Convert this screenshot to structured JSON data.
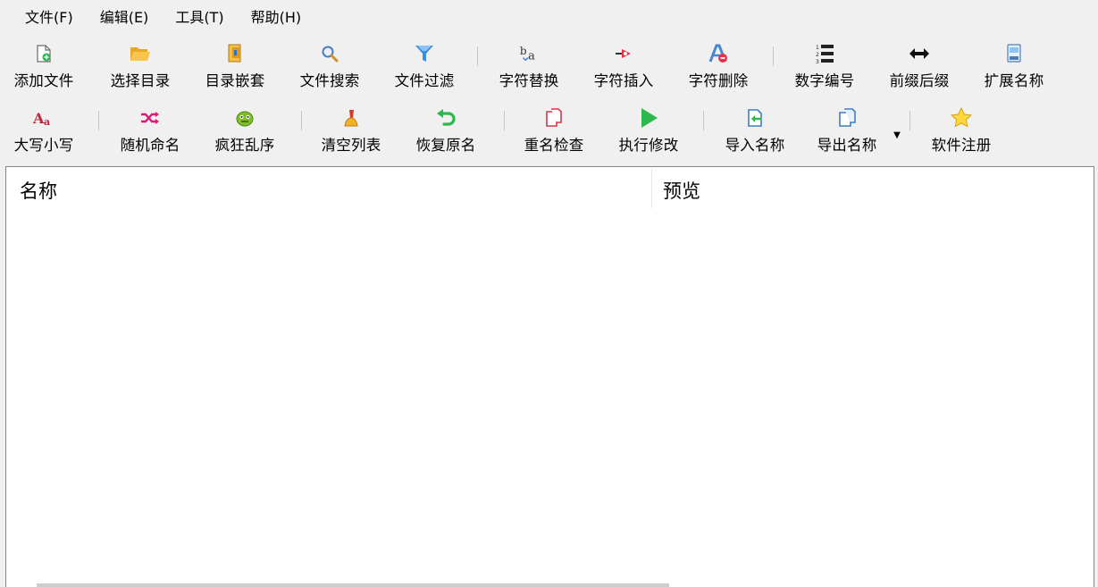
{
  "menu": {
    "file": "文件(F)",
    "edit": "编辑(E)",
    "tools": "工具(T)",
    "help": "帮助(H)"
  },
  "toolbar1": [
    {
      "label": "添加文件",
      "icon": "add-file-icon"
    },
    {
      "label": "选择目录",
      "icon": "folder-open-icon"
    },
    {
      "label": "目录嵌套",
      "icon": "nested-folder-icon"
    },
    {
      "label": "文件搜索",
      "icon": "search-icon"
    },
    {
      "label": "文件过滤",
      "icon": "filter-icon"
    },
    {
      "label": "字符替换",
      "icon": "replace-text-icon"
    },
    {
      "label": "字符插入",
      "icon": "insert-text-icon"
    },
    {
      "label": "字符删除",
      "icon": "delete-text-icon"
    },
    {
      "label": "数字编号",
      "icon": "numbered-list-icon"
    },
    {
      "label": "前缀后缀",
      "icon": "prefix-suffix-icon"
    },
    {
      "label": "扩展名称",
      "icon": "extension-icon"
    }
  ],
  "toolbar2": [
    {
      "label": "大写小写",
      "icon": "case-icon"
    },
    {
      "label": "随机命名",
      "icon": "shuffle-icon"
    },
    {
      "label": "疯狂乱序",
      "icon": "crazy-face-icon"
    },
    {
      "label": "清空列表",
      "icon": "broom-icon"
    },
    {
      "label": "恢复原名",
      "icon": "undo-icon"
    },
    {
      "label": "重名检查",
      "icon": "duplicate-check-icon"
    },
    {
      "label": "执行修改",
      "icon": "play-icon"
    },
    {
      "label": "导入名称",
      "icon": "import-icon"
    },
    {
      "label": "导出名称",
      "icon": "export-icon"
    },
    {
      "label": "软件注册",
      "icon": "star-icon"
    }
  ],
  "list": {
    "columns": [
      "名称",
      "预览"
    ]
  },
  "colors": {
    "background": "#f0f0f0",
    "list_background": "#ffffff",
    "accent_green": "#2db84d",
    "accent_blue": "#3c8de0",
    "accent_red": "#d9344a"
  }
}
